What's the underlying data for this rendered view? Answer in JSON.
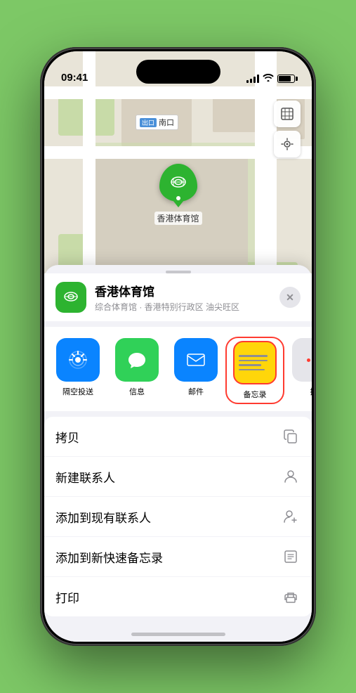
{
  "status_bar": {
    "time": "09:41",
    "location_arrow": "▲"
  },
  "map": {
    "label_badge": "出口",
    "label_text": "南口",
    "controls": {
      "map_btn": "🗺",
      "location_btn": "◎"
    }
  },
  "marker": {
    "label": "香港体育馆",
    "icon": "🏟"
  },
  "sheet": {
    "location_name": "香港体育馆",
    "location_subtitle": "综合体育馆 · 香港特别行政区 油尖旺区",
    "close_label": "✕"
  },
  "apps": [
    {
      "id": "airdrop",
      "label": "隔空投送",
      "type": "airdrop"
    },
    {
      "id": "messages",
      "label": "信息",
      "type": "messages"
    },
    {
      "id": "mail",
      "label": "邮件",
      "type": "mail"
    },
    {
      "id": "notes",
      "label": "备忘录",
      "type": "notes"
    },
    {
      "id": "more",
      "label": "推",
      "type": "more"
    }
  ],
  "actions": [
    {
      "id": "copy",
      "label": "拷贝",
      "icon": "copy"
    },
    {
      "id": "new-contact",
      "label": "新建联系人",
      "icon": "person"
    },
    {
      "id": "add-existing",
      "label": "添加到现有联系人",
      "icon": "person-add"
    },
    {
      "id": "add-notes",
      "label": "添加到新快速备忘录",
      "icon": "note"
    },
    {
      "id": "print",
      "label": "打印",
      "icon": "printer"
    }
  ]
}
